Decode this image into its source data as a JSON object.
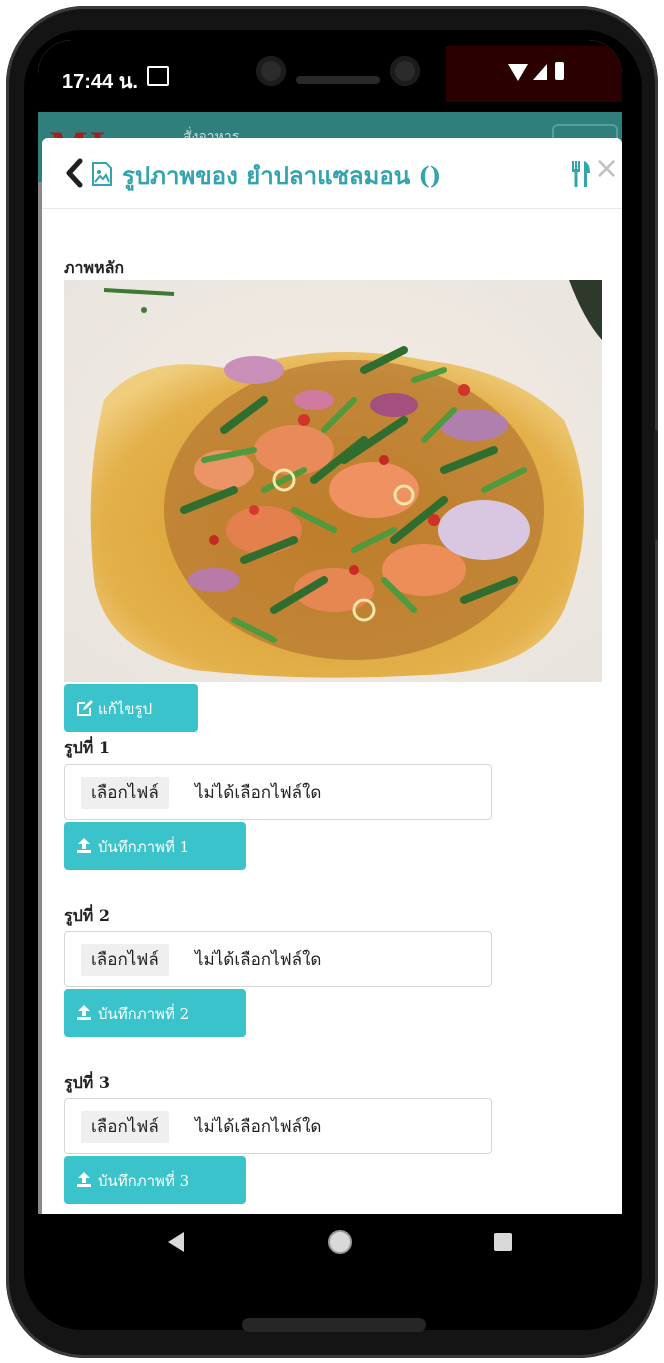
{
  "status_bar": {
    "time": "17:44 น."
  },
  "background_page": {
    "logo_text": "MI",
    "nav_label": "สั่งอาหาร"
  },
  "modal": {
    "title": "รูปภาพของ ยำปลาแซลมอน ()",
    "main_image_label": "ภาพหลัก",
    "main_image_alt": "ยำปลาแซลมอน",
    "edit_button_label": "แก้ไขรูป",
    "slots": [
      {
        "label": "รูปที่ 1",
        "choose_file_label": "เลือกไฟล์",
        "file_status": "ไม่ได้เลือกไฟล์ใด",
        "upload_button_label": "บันทึกภาพที่ 1"
      },
      {
        "label": "รูปที่ 2",
        "choose_file_label": "เลือกไฟล์",
        "file_status": "ไม่ได้เลือกไฟล์ใด",
        "upload_button_label": "บันทึกภาพที่ 2"
      },
      {
        "label": "รูปที่ 3",
        "choose_file_label": "เลือกไฟล์",
        "file_status": "ไม่ได้เลือกไฟล์ใด",
        "upload_button_label": "บันทึกภาพที่ 3"
      }
    ]
  },
  "colors": {
    "accent": "#3ac3cb",
    "title": "#33a4ad",
    "header_bg": "#2f7f7d"
  },
  "icons": [
    "back-icon",
    "picture-icon",
    "utensils-icon",
    "close-icon",
    "edit-icon",
    "upload-icon",
    "nav-back-icon",
    "nav-home-icon",
    "nav-recents-icon"
  ]
}
